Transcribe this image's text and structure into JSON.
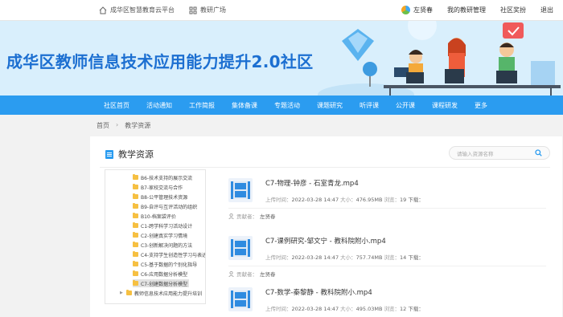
{
  "topbar": {
    "home_label": "成华区智慧教育云平台",
    "square_label": "教研广场",
    "user_name": "左贤春",
    "my_teaching": "我的教研管理",
    "community_points": "社区奖扮",
    "logout": "退出"
  },
  "banner": {
    "title": "成华区教师信息技术应用能力提升2.0社区"
  },
  "nav": [
    "社区首页",
    "活动通知",
    "工作简报",
    "集体备课",
    "专题活动",
    "课题研究",
    "听评课",
    "公开课",
    "课程研发",
    "更多"
  ],
  "breadcrumb": {
    "home": "首页",
    "current": "教学资源"
  },
  "panel": {
    "title": "教学资源",
    "search_placeholder": "请输入资源名称"
  },
  "tree": [
    "B6-技术支持的展示交流",
    "B7-家校交流与合作",
    "B8-公平管理技术资源",
    "B9-自评与互评活动的组织",
    "B10-档案袋评价",
    "C1-跨学科学习活动设计",
    "C2-创建真实学习情境",
    "C3-创新解决问题的方法",
    "C4-支持学生创造性学习与表达",
    "C5-基于数据的个别化指导",
    "C6-应用数据分析模型",
    "C7-创建数据分析模型",
    "教师信息技术应用能力提升培训"
  ],
  "resources": [
    {
      "name": "C7-物理-钟彦 - 石室青龙.mp4",
      "upload_label": "上传时间：",
      "upload_time": "2022-03-28 14:47",
      "size_label": "大小：",
      "size": "476.95MB",
      "views_label": "浏览：",
      "views": "19 下载：",
      "contrib_label": "贡献者：",
      "contributor": "左贤春"
    },
    {
      "name": "C7-课例研究-邹文宁 - 教科院附小.mp4",
      "upload_label": "上传时间：",
      "upload_time": "2022-03-28 14:47",
      "size_label": "大小：",
      "size": "757.74MB",
      "views_label": "浏览：",
      "views": "14 下载：",
      "contrib_label": "贡献者：",
      "contributor": "左贤春"
    },
    {
      "name": "C7-数学-秦黎静 - 教科院附小.mp4",
      "upload_label": "上传时间：",
      "upload_time": "2022-03-28 14:47",
      "size_label": "大小：",
      "size": "495.03MB",
      "views_label": "浏览：",
      "views": "12 下载："
    }
  ]
}
